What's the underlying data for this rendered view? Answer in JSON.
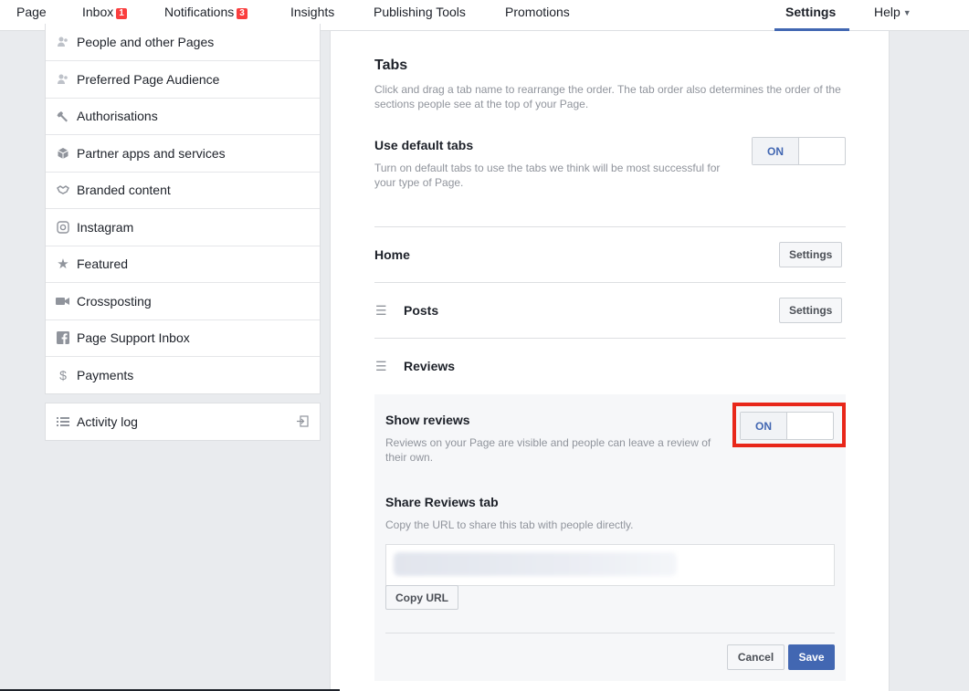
{
  "nav": {
    "items": [
      {
        "label": "Page"
      },
      {
        "label": "Inbox",
        "badge": "1"
      },
      {
        "label": "Notifications",
        "badge": "3"
      },
      {
        "label": "Insights"
      },
      {
        "label": "Publishing Tools"
      },
      {
        "label": "Promotions"
      }
    ],
    "settings": "Settings",
    "help": "Help"
  },
  "sidebar": {
    "items": [
      {
        "label": "People and other Pages",
        "icon": "people-icon"
      },
      {
        "label": "Preferred Page Audience",
        "icon": "audience-icon"
      },
      {
        "label": "Authorisations",
        "icon": "wrench-icon"
      },
      {
        "label": "Partner apps and services",
        "icon": "box-icon"
      },
      {
        "label": "Branded content",
        "icon": "handshake-icon"
      },
      {
        "label": "Instagram",
        "icon": "instagram-icon"
      },
      {
        "label": "Featured",
        "icon": "star-icon"
      },
      {
        "label": "Crossposting",
        "icon": "video-camera-icon"
      },
      {
        "label": "Page Support Inbox",
        "icon": "facebook-icon"
      },
      {
        "label": "Payments",
        "icon": "dollar-icon"
      }
    ],
    "activity_log": "Activity log"
  },
  "tabs": {
    "title": "Tabs",
    "description": "Click and drag a tab name to rearrange the order. The tab order also determines the order of the sections people see at the top of your Page.",
    "default_label": "Use default tabs",
    "default_desc": "Turn on default tabs to use the tabs we think will be most successful for your type of Page.",
    "toggle_on": "ON",
    "home": "Home",
    "posts": "Posts",
    "reviews": "Reviews",
    "settings_btn": "Settings"
  },
  "reviews": {
    "show_label": "Show reviews",
    "show_desc": "Reviews on your Page are visible and people can leave a review of their own.",
    "toggle_on": "ON",
    "share_label": "Share Reviews tab",
    "share_desc": "Copy the URL to share this tab with people directly.",
    "copy_url": "Copy URL",
    "cancel": "Cancel",
    "save": "Save"
  },
  "colors": {
    "accent": "#4267b2",
    "highlight": "#e8271a",
    "badge": "#fa3e3e"
  }
}
